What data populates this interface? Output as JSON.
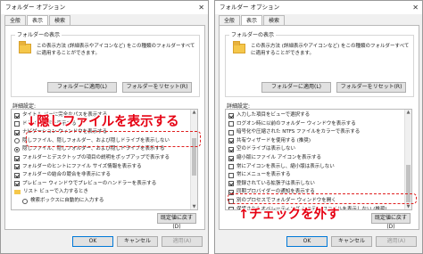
{
  "window_title": "フォルダー オプション",
  "close_glyph": "✕",
  "tabs": [
    "全般",
    "表示",
    "検索"
  ],
  "group": {
    "title": "フォルダーの表示",
    "description": "この表示方法 (詳細表示やアイコンなど) をこの種類のフォルダーすべてに適用することができます。",
    "apply_button": "フォルダーに適用(L)",
    "reset_button": "フォルダーをリセット(R)"
  },
  "advanced_label": "詳細設定:",
  "left_list": [
    {
      "kind": "cb",
      "on": true,
      "text": "タイトル バーに完全なパスを表示する"
    },
    {
      "kind": "cb",
      "on": false,
      "text": "ドライブ文字を表示する"
    },
    {
      "kind": "cb",
      "on": true,
      "text": "ナビゲーション ウィンドウを表示する"
    },
    {
      "kind": "rb",
      "on": false,
      "text": "隠しファイル、隠しフォルダー、および隠しドライブを表示しない"
    },
    {
      "kind": "rb",
      "on": true,
      "text": "隠しファイル、隠しフォルダー、および隠しドライブを表示する"
    },
    {
      "kind": "cb",
      "on": true,
      "text": "フォルダーとデスクトップの項目の説明をポップアップで表示する"
    },
    {
      "kind": "cb",
      "on": true,
      "text": "フォルダーのヒントにファイル サイズ情報を表示する"
    },
    {
      "kind": "cb",
      "on": true,
      "text": "フォルダーの結合の競合を非表示にする"
    },
    {
      "kind": "cb",
      "on": true,
      "text": "プレビュー ウィンドウでプレビューのハンドラーを表示する"
    },
    {
      "kind": "fold",
      "on": false,
      "text": "リスト ビューで入力するとき"
    },
    {
      "kind": "rb",
      "on": false,
      "text": "検索ボックスに自動的に入力する"
    }
  ],
  "right_list": [
    {
      "kind": "cb",
      "on": true,
      "text": "入力した項目をビューで選択する"
    },
    {
      "kind": "cb",
      "on": false,
      "text": "ログオン時に以前のフォルダー ウィンドウを表示する"
    },
    {
      "kind": "cb",
      "on": false,
      "text": "暗号化や圧縮された NTFS ファイルをカラーで表示する"
    },
    {
      "kind": "cb",
      "on": true,
      "text": "共有ウィザードを使用する (推奨)"
    },
    {
      "kind": "cb",
      "on": true,
      "text": "空のドライブは表示しない"
    },
    {
      "kind": "cb",
      "on": true,
      "text": "縮小版にファイル アイコンを表示する"
    },
    {
      "kind": "cb",
      "on": false,
      "text": "常にアイコンを表示し、縮小版は表示しない"
    },
    {
      "kind": "cb",
      "on": false,
      "text": "常にメニューを表示する"
    },
    {
      "kind": "cb",
      "on": true,
      "text": "登録されている拡張子は表示しない"
    },
    {
      "kind": "cb",
      "on": true,
      "text": "同期プロバイダーの通知を表示する"
    },
    {
      "kind": "cb",
      "on": false,
      "text": "別のプロセスでフォルダー ウィンドウを開く"
    },
    {
      "kind": "cb",
      "on": false,
      "text": "保護されたオペレーティング システム ファイルを表示しない (推奨)"
    }
  ],
  "restore_button": "既定値に戻す(D)",
  "footer": {
    "ok": "OK",
    "cancel": "キャンセル",
    "apply": "適用(A)"
  },
  "callouts": {
    "left": "↓隠しファイルを表示する",
    "right": "↑チェックを外す"
  },
  "colors": {
    "accent_red": "#e60012",
    "window_bg": "#f0f0f0",
    "focus_blue": "#0078d7"
  }
}
